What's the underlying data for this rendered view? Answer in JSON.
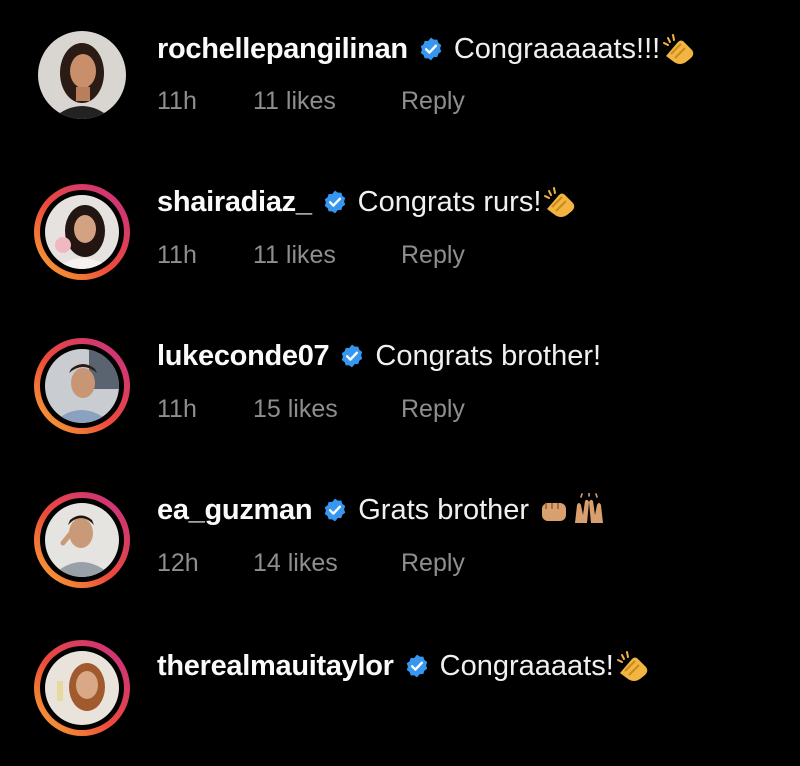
{
  "comments": [
    {
      "username": "rochellepangilinan",
      "text": "Congraaaaats!!!",
      "emoji": "clapping-hands",
      "time": "11h",
      "likes": "11 likes",
      "reply": "Reply",
      "story_ring": false
    },
    {
      "username": "shairadiaz_",
      "text": "Congrats rurs!",
      "emoji": "clapping-hands",
      "time": "11h",
      "likes": "11 likes",
      "reply": "Reply",
      "story_ring": true
    },
    {
      "username": "lukeconde07",
      "text": "Congrats brother!",
      "emoji": "",
      "time": "11h",
      "likes": "15 likes",
      "reply": "Reply",
      "story_ring": true
    },
    {
      "username": "ea_guzman",
      "text": "Grats brother",
      "emoji": "fist-bump-and-raised-hands",
      "time": "12h",
      "likes": "14 likes",
      "reply": "Reply",
      "story_ring": true
    },
    {
      "username": "therealmauitaylor",
      "text": "Congraaaats!",
      "emoji": "clapping-hands",
      "time": "",
      "likes": "",
      "reply": "",
      "story_ring": true
    }
  ],
  "colors": {
    "background": "#000000",
    "username": "#fafafa",
    "meta": "#8e8e8e",
    "verified": "#3797f0",
    "ring_start": "#f8b133",
    "ring_end": "#c42e8a"
  }
}
